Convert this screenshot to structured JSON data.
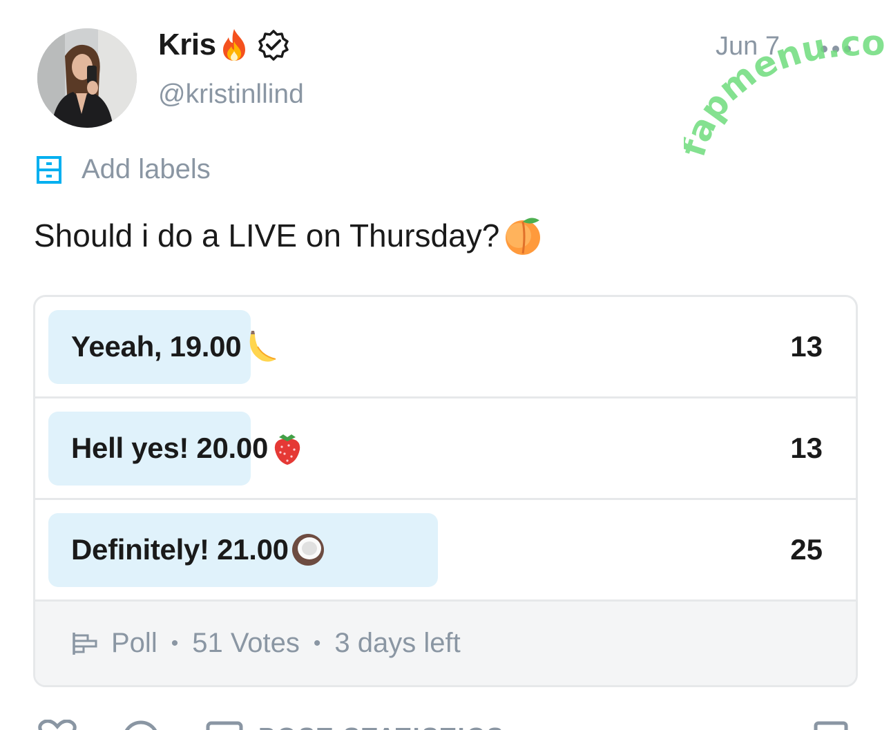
{
  "post": {
    "author": {
      "display_name": "Kris",
      "handle": "@kristinllind",
      "verified": true,
      "name_emoji": "fire-emoji"
    },
    "date": "Jun 7",
    "menu_icon": "more-dots-icon",
    "labels_button": {
      "icon": "labels-icon",
      "text": "Add labels"
    },
    "text": "Should i do a LIVE on Thursday?",
    "text_emoji": "peach-emoji"
  },
  "poll": {
    "options": [
      {
        "label": "Yeeah, 19.00",
        "emoji": "banana-emoji",
        "votes": "13",
        "vote_count": 13
      },
      {
        "label": "Hell yes! 20.00",
        "emoji": "strawberry-emoji",
        "votes": "13",
        "vote_count": 13
      },
      {
        "label": "Definitely! 21.00",
        "emoji": "coconut-emoji",
        "votes": "25",
        "vote_count": 25
      }
    ],
    "footer": {
      "type": "Poll",
      "votes": "51 Votes",
      "time_left": "3 days left",
      "separator": "•"
    },
    "fill_color": "#e0f2fb"
  },
  "actions": {
    "stats_label": "POST STATISTICS"
  },
  "watermark": "fapmenu.com",
  "colors": {
    "muted_text": "#8a96a3",
    "accent": "#00aff0",
    "watermark": "#6fdc7c"
  }
}
